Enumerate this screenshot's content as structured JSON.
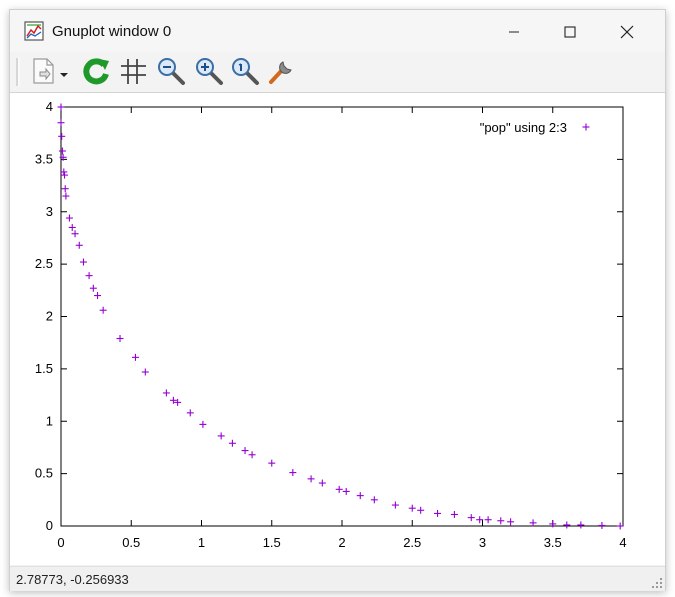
{
  "window": {
    "title": "Gnuplot window 0",
    "minimize_icon": "minimize-icon",
    "maximize_icon": "maximize-icon",
    "close_icon": "close-icon"
  },
  "toolbar": {
    "buttons": [
      {
        "name": "copy-icon"
      },
      {
        "name": "dropdown-arrow-icon"
      },
      {
        "name": "replot-icon"
      },
      {
        "name": "grid-icon"
      },
      {
        "name": "zoom-out-icon"
      },
      {
        "name": "zoom-in-icon"
      },
      {
        "name": "zoom-autoscale-icon"
      },
      {
        "name": "options-wrench-icon"
      }
    ]
  },
  "status": {
    "coordinates": "2.78773, -0.256933"
  },
  "colors": {
    "series": "#9400d3"
  },
  "chart_data": {
    "type": "scatter",
    "title": "",
    "xlabel": "",
    "ylabel": "",
    "xlim": [
      0,
      4
    ],
    "ylim": [
      0,
      4
    ],
    "xticks": [
      "0",
      "0.5",
      "1",
      "1.5",
      "2",
      "2.5",
      "3",
      "3.5",
      "4"
    ],
    "yticks": [
      "0",
      "0.5",
      "1",
      "1.5",
      "2",
      "2.5",
      "3",
      "3.5",
      "4"
    ],
    "grid": false,
    "legend_position": "top-right",
    "series": [
      {
        "name": "\"pop\" using 2:3",
        "marker": "+",
        "points": [
          [
            0.0,
            4.0
          ],
          [
            0.0,
            3.85
          ],
          [
            0.005,
            3.72
          ],
          [
            0.01,
            3.58
          ],
          [
            0.015,
            3.52
          ],
          [
            0.02,
            3.38
          ],
          [
            0.025,
            3.35
          ],
          [
            0.03,
            3.22
          ],
          [
            0.035,
            3.15
          ],
          [
            0.06,
            2.94
          ],
          [
            0.08,
            2.85
          ],
          [
            0.1,
            2.79
          ],
          [
            0.13,
            2.68
          ],
          [
            0.16,
            2.52
          ],
          [
            0.2,
            2.39
          ],
          [
            0.23,
            2.27
          ],
          [
            0.26,
            2.2
          ],
          [
            0.3,
            2.06
          ],
          [
            0.42,
            1.79
          ],
          [
            0.53,
            1.61
          ],
          [
            0.6,
            1.47
          ],
          [
            0.75,
            1.27
          ],
          [
            0.8,
            1.2
          ],
          [
            0.83,
            1.18
          ],
          [
            0.92,
            1.08
          ],
          [
            1.01,
            0.97
          ],
          [
            1.14,
            0.86
          ],
          [
            1.22,
            0.79
          ],
          [
            1.31,
            0.72
          ],
          [
            1.36,
            0.68
          ],
          [
            1.5,
            0.6
          ],
          [
            1.65,
            0.51
          ],
          [
            1.78,
            0.45
          ],
          [
            1.86,
            0.41
          ],
          [
            1.98,
            0.35
          ],
          [
            2.03,
            0.33
          ],
          [
            2.13,
            0.29
          ],
          [
            2.23,
            0.25
          ],
          [
            2.38,
            0.2
          ],
          [
            2.5,
            0.17
          ],
          [
            2.56,
            0.15
          ],
          [
            2.68,
            0.12
          ],
          [
            2.8,
            0.11
          ],
          [
            2.92,
            0.08
          ],
          [
            2.98,
            0.06
          ],
          [
            3.04,
            0.06
          ],
          [
            3.13,
            0.05
          ],
          [
            3.2,
            0.04
          ],
          [
            3.36,
            0.03
          ],
          [
            3.5,
            0.02
          ],
          [
            3.6,
            0.01
          ],
          [
            3.7,
            0.01
          ],
          [
            3.85,
            0.005
          ],
          [
            3.98,
            0.0
          ]
        ]
      }
    ]
  }
}
